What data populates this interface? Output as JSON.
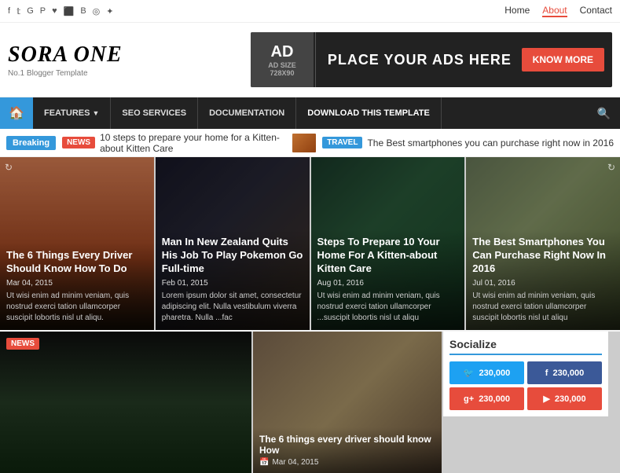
{
  "topbar": {
    "icons": [
      "f",
      "t",
      "g+",
      "p",
      "♥",
      "rss",
      "be",
      "ins",
      "☆"
    ],
    "nav": [
      {
        "label": "Home",
        "active": false
      },
      {
        "label": "About",
        "active": true
      },
      {
        "label": "Contact",
        "active": false
      }
    ]
  },
  "header": {
    "brand_title": "SORA ONE",
    "brand_sub": "No.1 Blogger Template",
    "ad_label": "AD",
    "ad_size": "AD SIZE\n728X90",
    "ad_text": "PLACE YOUR ADS HERE",
    "ad_btn": "KNOW MORE"
  },
  "navbar": {
    "items": [
      {
        "label": "FEATURES",
        "has_arrow": true
      },
      {
        "label": "SEO SERVICES",
        "has_arrow": false
      },
      {
        "label": "DOCUMENTATION",
        "has_arrow": false
      },
      {
        "label": "DOWNLOAD THIS TEMPLATE",
        "has_arrow": false
      }
    ]
  },
  "breaking": {
    "badge": "Breaking",
    "news_badge": "NEWS",
    "text": "10 steps to prepare your home for a Kitten-about Kitten Care",
    "travel_badge": "TRAVEL",
    "text2": "The Best smartphones you can purchase right now in 2016"
  },
  "cards": [
    {
      "title": "The 6 Things Every Driver Should Know How To Do",
      "date": "Mar 04, 2015",
      "excerpt": "Ut wisi enim ad minim veniam, quis nostrud exerci tation ullamcorper suscipit lobortis nisl ut aliqu.",
      "bg_class": "img-person1"
    },
    {
      "title": "Man In New Zealand Quits His Job To Play Pokemon Go Full-time",
      "date": "Feb 01, 2015",
      "excerpt": "Lorem ipsum dolor sit amet, consectetur adipiscing elit. Nulla vestibulum viverra pharetra. Nulla ...fac",
      "bg_class": "img-city"
    },
    {
      "title": "Steps To Prepare 10 Your Home For A Kitten-about Kitten Care",
      "date": "Aug 01, 2016",
      "excerpt": "Ut wisi enim ad minim veniam, quis nostrud exerci tation ullamcorper ...suscipit lobortis nisl ut aliqu",
      "bg_class": "img-forest2"
    },
    {
      "title": "The Best Smartphones You Can Purchase Right Now In 2016",
      "date": "Jul 01, 2016",
      "excerpt": "Ut wisi enim ad minim veniam, quis nostrud exerci tation ullamcorper suscipit lobortis nisl ut aliqu",
      "bg_class": "img-nature"
    }
  ],
  "bottom_cards": [
    {
      "badge": "NEWS",
      "title": "",
      "bg_class": "img-forest3"
    },
    {
      "title": "The 6 things every driver should know How",
      "date": "Mar 04, 2015",
      "bg_class": "img-outdoor"
    }
  ],
  "socialize": {
    "title": "Socialize",
    "buttons": [
      {
        "label": "230,000",
        "icon": "🐦",
        "class": "social-twitter"
      },
      {
        "label": "230,000",
        "icon": "f",
        "class": "social-facebook"
      },
      {
        "label": "230,000",
        "icon": "g+",
        "class": "social-google"
      },
      {
        "label": "230,000",
        "icon": "▶",
        "class": "social-youtube"
      }
    ]
  }
}
